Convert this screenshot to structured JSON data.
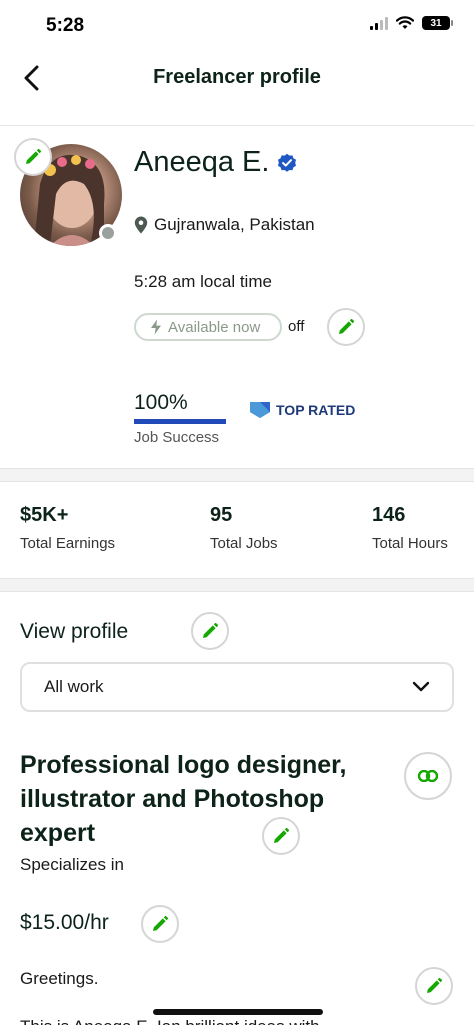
{
  "status_bar": {
    "time": "5:28",
    "battery": "31"
  },
  "nav": {
    "title": "Freelancer profile"
  },
  "profile": {
    "name": "Aneeqa E.",
    "location": "Gujranwala, Pakistan",
    "local_time": "5:28 am local time",
    "availability_label": "Available now",
    "availability_state": "off",
    "job_success_value": "100%",
    "job_success_fraction": 1.0,
    "job_success_label": "Job Success",
    "top_rated_label": "TOP RATED"
  },
  "stats": [
    {
      "value": "$5K+",
      "label": "Total Earnings"
    },
    {
      "value": "95",
      "label": "Total Jobs"
    },
    {
      "value": "146",
      "label": "Total Hours"
    }
  ],
  "profile_section": {
    "title": "View profile",
    "dropdown_value": "All work",
    "headline": "Professional logo designer, illustrator and Photoshop expert",
    "specializes_label": "Specializes in",
    "rate": "$15.00/hr",
    "greeting": "Greetings.",
    "bio_partial": "This is Aneeqa E. Ian brilliant ideas with"
  },
  "colors": {
    "brand_green": "#14a800",
    "dark_green": "#0d2319",
    "job_success_blue": "#1f4ab8",
    "verified_blue": "#1f57c3",
    "top_rated_blue": "#1f3a7a"
  }
}
